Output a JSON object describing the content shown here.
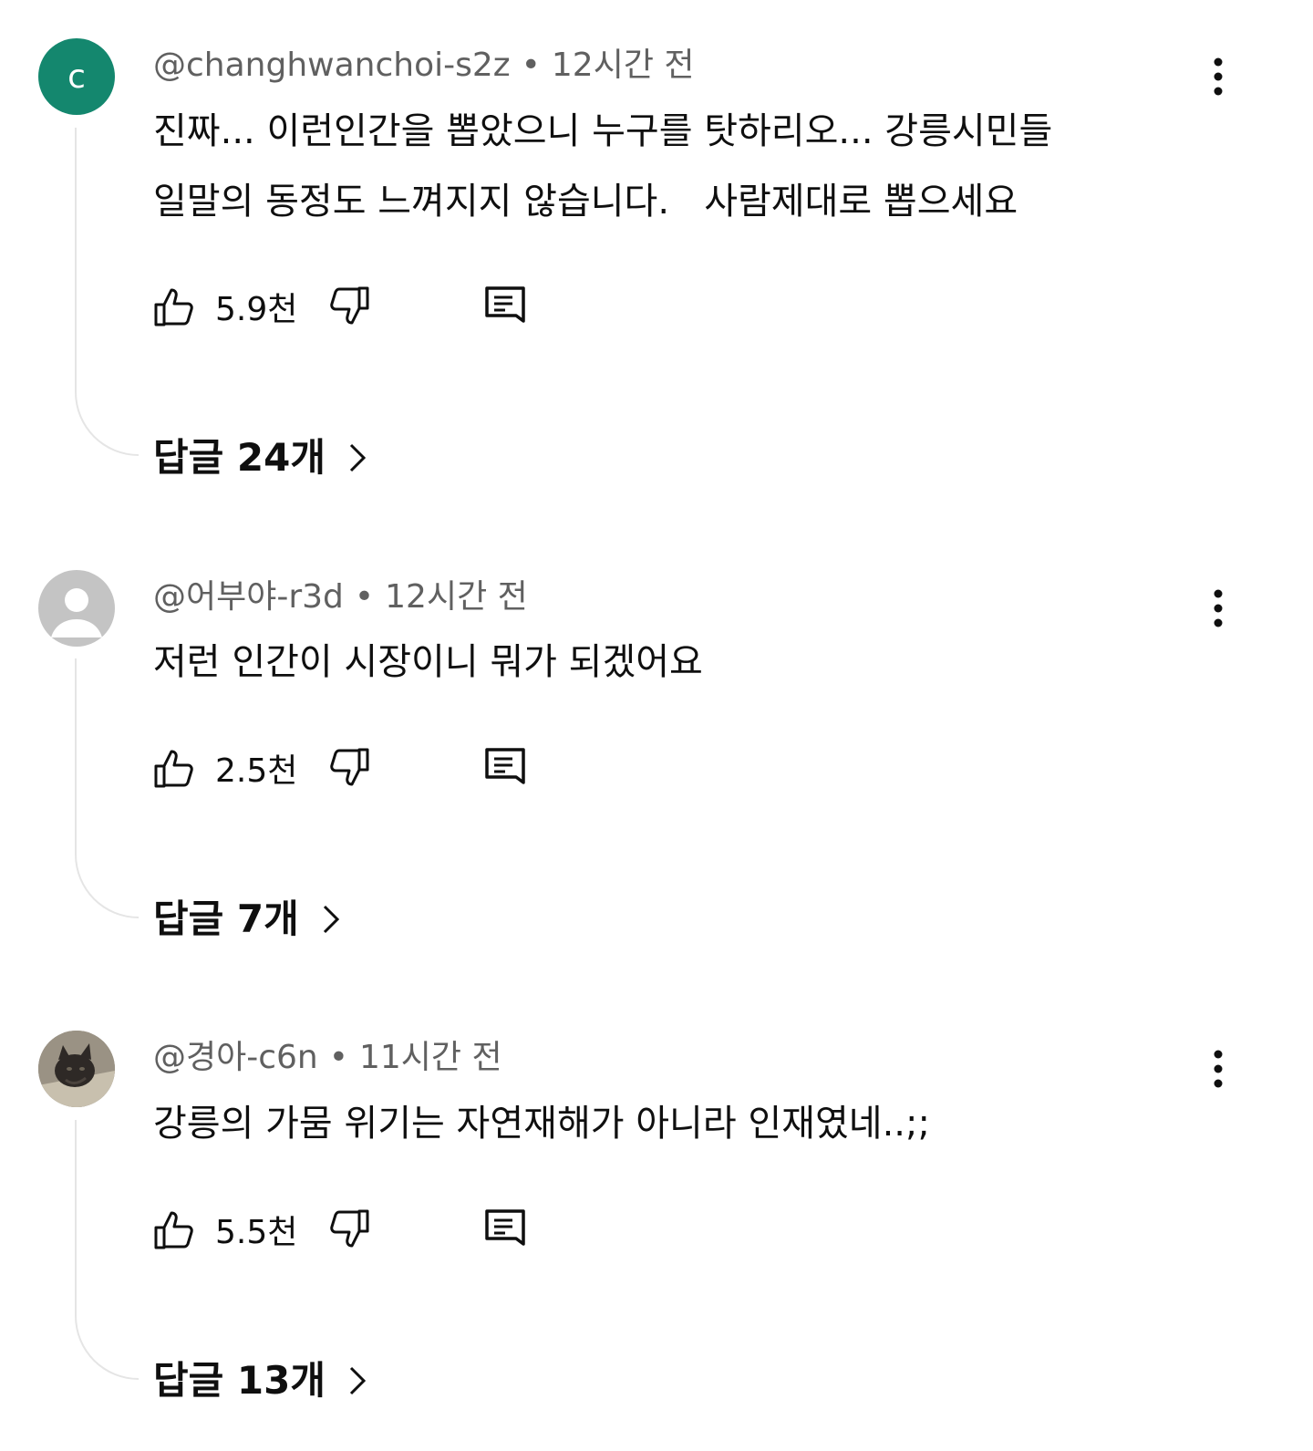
{
  "comments": [
    {
      "avatar_letter": "c",
      "author": "@changhwanchoi-s2z",
      "separator": "•",
      "time": "12시간 전",
      "lines": [
        "진짜... 이런인간을 뽑았으니 누구를 탓하리오... 강릉시민들",
        "일말의 동정도 느껴지지 않습니다.   사람제대로 뽑으세요"
      ],
      "likes": "5.9천",
      "replies": "답글 24개"
    },
    {
      "author": "@어부야-r3d",
      "separator": "•",
      "time": "12시간 전",
      "lines": [
        "저런 인간이 시장이니 뭐가 되겠어요"
      ],
      "likes": "2.5천",
      "replies": "답글 7개"
    },
    {
      "author": "@경아-c6n",
      "separator": "•",
      "time": "11시간 전",
      "lines": [
        "강릉의 가뭄 위기는 자연재해가 아니라 인재였네..;;"
      ],
      "likes": "5.5천",
      "replies": "답글 13개"
    }
  ],
  "icons": {
    "like": "thumbs-up-icon",
    "dislike": "thumbs-down-icon",
    "reply": "comment-reply-icon",
    "more": "more-vertical-icon",
    "chevron": "chevron-right-icon"
  },
  "colors": {
    "avatar_green": "#14876e",
    "meta_gray": "#606060",
    "text": "#0f0f0f"
  }
}
